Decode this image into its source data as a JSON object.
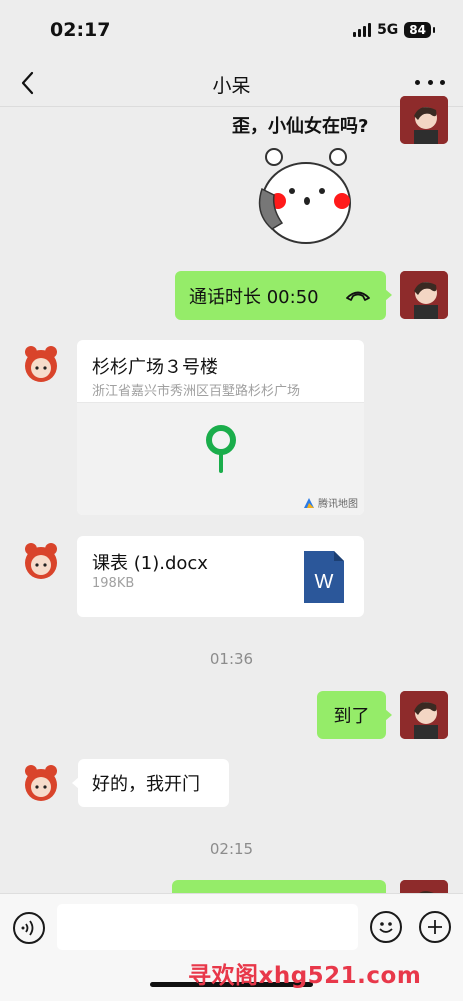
{
  "status": {
    "time": "02:17",
    "network": "5G",
    "battery": "84"
  },
  "header": {
    "title": "小呆"
  },
  "messages": {
    "sticker_caption": "歪，小仙女在吗?",
    "call": {
      "label": "通话时长 00:50"
    },
    "location": {
      "title": "杉杉广场３号楼",
      "address": "浙江省嘉兴市秀洲区百墅路杉杉广场",
      "map_brand": "腾讯地图"
    },
    "file": {
      "name": "课表 (1).docx",
      "size": "198KB",
      "icon_letter": "W"
    },
    "time1": "01:36",
    "msg_arrived": "到了",
    "msg_reply": "好的，我开门",
    "time2": "02:15"
  },
  "watermark": "寻欢阁xhg521.com",
  "colors": {
    "bubble_mine": "#95ec69",
    "bubble_other": "#ffffff",
    "background": "#ededed",
    "pin": "#1aad4b",
    "word_blue": "#2b579a"
  },
  "icons": [
    "back-chevron-icon",
    "more-icon",
    "phone-hangup-icon",
    "map-pin-icon",
    "tencent-map-icon",
    "word-doc-icon",
    "voice-icon",
    "emoji-icon",
    "add-icon"
  ]
}
